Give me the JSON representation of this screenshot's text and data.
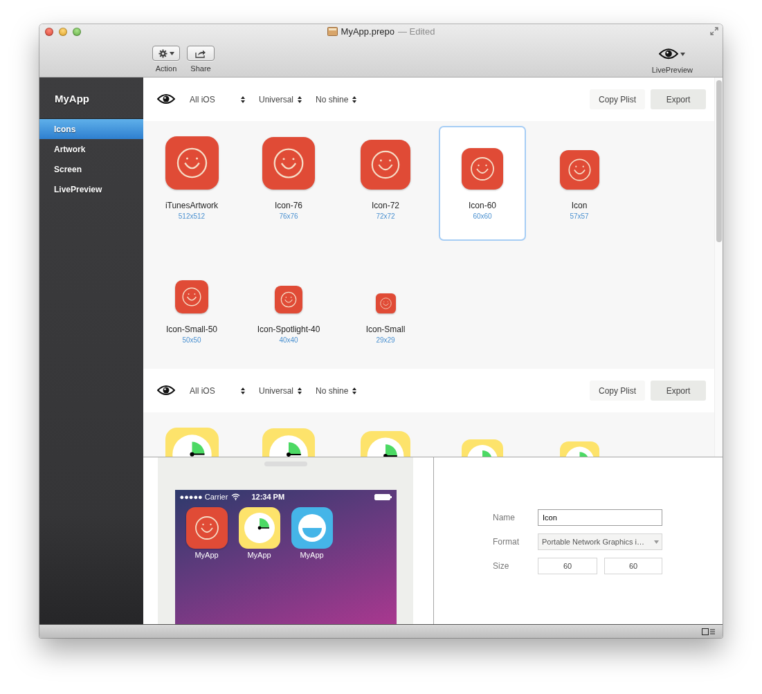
{
  "window": {
    "title": "MyApp.prepo",
    "status": "— Edited"
  },
  "toolbar": {
    "left": [
      {
        "label": "Action",
        "kind": "gear"
      },
      {
        "label": "Share",
        "kind": "share"
      }
    ],
    "right": [
      {
        "label": "LivePreview",
        "kind": "eye"
      }
    ]
  },
  "sidebar": {
    "title": "MyApp",
    "items": [
      {
        "label": "Icons",
        "selected": true
      },
      {
        "label": "Artwork",
        "selected": false
      },
      {
        "label": "Screen",
        "selected": false
      },
      {
        "label": "LivePreview",
        "selected": false
      }
    ]
  },
  "sections": [
    {
      "filters": [
        {
          "label": "All iOS"
        },
        {
          "label": "Universal"
        },
        {
          "label": "No shine"
        }
      ],
      "buttons": [
        {
          "label": "Copy Plist",
          "kind": "light"
        },
        {
          "label": "Export",
          "kind": "shaded"
        }
      ],
      "icons": [
        {
          "kind": "smile",
          "name": "iTunesArtwork",
          "size": "512x512",
          "selected": false
        },
        {
          "kind": "smile",
          "name": "Icon-76",
          "size": "76x76",
          "selected": false
        },
        {
          "kind": "smile",
          "name": "Icon-72",
          "size": "72x72",
          "selected": false
        },
        {
          "kind": "smile",
          "name": "Icon-60",
          "size": "60x60",
          "selected": true
        },
        {
          "kind": "smile",
          "name": "Icon",
          "size": "57x57",
          "selected": false
        },
        {
          "kind": "smile",
          "name": "Icon-Small-50",
          "size": "50x50",
          "selected": false
        },
        {
          "kind": "smile",
          "name": "Icon-Spotlight-40",
          "size": "40x40",
          "selected": false
        },
        {
          "kind": "smile",
          "name": "Icon-Small",
          "size": "29x29",
          "selected": false
        }
      ]
    },
    {
      "filters": [
        {
          "label": "All iOS"
        },
        {
          "label": "Universal"
        },
        {
          "label": "No shine"
        }
      ],
      "buttons": [
        {
          "label": "Copy Plist",
          "kind": "light"
        },
        {
          "label": "Export",
          "kind": "shaded"
        }
      ],
      "icons": [
        {
          "kind": "timer",
          "selected": false
        },
        {
          "kind": "timer",
          "selected": false
        },
        {
          "kind": "timer",
          "selected": false
        },
        {
          "kind": "timer",
          "selected": false
        },
        {
          "kind": "timer",
          "selected": false
        }
      ]
    }
  ],
  "preview": {
    "status_bar": {
      "carrier": "●●●●● Carrier",
      "time": "12:34 PM"
    },
    "apps": [
      {
        "kind": "smile",
        "label": "MyApp"
      },
      {
        "kind": "timer",
        "label": "MyApp"
      },
      {
        "kind": "drop",
        "label": "MyApp"
      }
    ]
  },
  "inspector": {
    "fields": [
      {
        "kind": "text",
        "label": "Name",
        "value": "Icon"
      },
      {
        "kind": "select",
        "label": "Format",
        "value": "Portable Network Graphics i…"
      },
      {
        "kind": "pair",
        "label": "Size",
        "values": [
          "60",
          "60"
        ]
      }
    ]
  }
}
